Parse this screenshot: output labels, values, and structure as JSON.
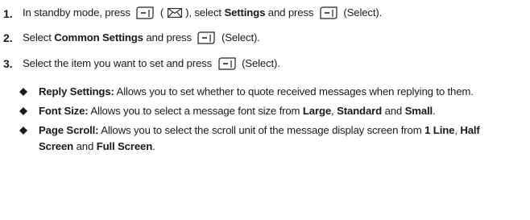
{
  "steps": [
    {
      "number": "1.",
      "parts": {
        "a": "In standby mode, press",
        "b": "(",
        "c": "), select",
        "d": "Settings",
        "e": "and press",
        "f": "(Select)."
      }
    },
    {
      "number": "2.",
      "parts": {
        "a": "Select",
        "b": "Common Settings",
        "c": "and press",
        "d": "(Select)."
      }
    },
    {
      "number": "3.",
      "parts": {
        "a": "Select the item you want to set and press",
        "b": "(Select)."
      }
    }
  ],
  "bullets": [
    {
      "term": "Reply Settings:",
      "text": "Allows you to set whether to quote received messages when replying to them."
    },
    {
      "term": "Font Size:",
      "text_a": "Allows you to select a message font size from",
      "opt1": "Large",
      "sep1": ",",
      "opt2": "Standard",
      "sep2": "and",
      "opt3": "Small",
      "end": "."
    },
    {
      "term": "Page Scroll:",
      "text_a": "Allows you to select the scroll unit of the message display screen from",
      "opt1": "1 Line",
      "sep1": ",",
      "opt2": "Half Screen",
      "sep2": "and",
      "opt3": "Full Screen",
      "end": "."
    }
  ],
  "icons": {
    "softkey": "left-softkey-icon",
    "envelope": "envelope-icon",
    "bullet": "diamond-bullet-icon"
  },
  "colors": {
    "text": "#1a1a1a",
    "icon_stroke": "#222222"
  }
}
